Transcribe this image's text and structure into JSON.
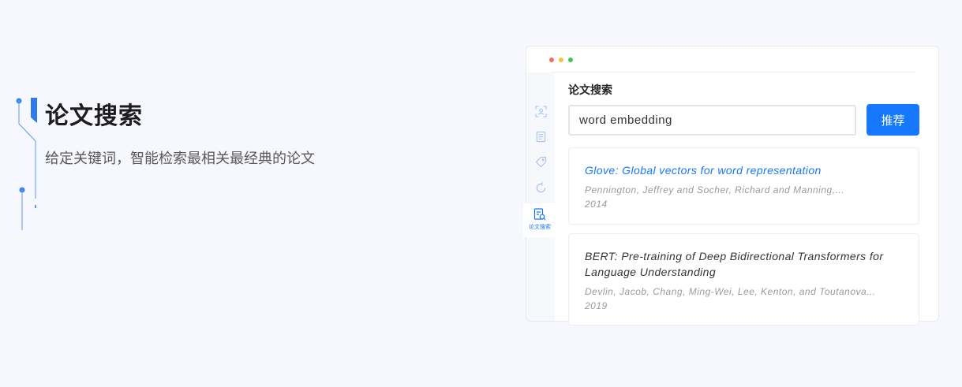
{
  "hero": {
    "title": "论文搜索",
    "subtitle": "给定关键词，智能检索最相关最经典的论文"
  },
  "window": {
    "sidebar": {
      "items": [
        {
          "icon": "scan-icon"
        },
        {
          "icon": "document-list-icon"
        },
        {
          "icon": "tag-icon"
        },
        {
          "icon": "refresh-icon"
        },
        {
          "icon": "paper-search-icon",
          "label": "论文搜索",
          "active": true
        }
      ]
    },
    "main": {
      "heading": "论文搜索",
      "search": {
        "value": "word embedding"
      },
      "recommend_button": "推荐",
      "results": [
        {
          "title": "Glove: Global vectors for word representation",
          "authors": "Pennington, Jeffrey and Socher, Richard and Manning,...",
          "year": "2014"
        },
        {
          "title": "BERT: Pre-training of Deep Bidirectional Transformers for Language Understanding",
          "authors": "Devlin, Jacob, Chang, Ming-Wei, Lee, Kenton, and Toutanova...",
          "year": "2019"
        }
      ]
    }
  },
  "colors": {
    "page_background": "#f7f8fd",
    "accent": "#1677ff",
    "sidebar_icon": "#a9c3ee",
    "window_controls": [
      "#f56c5c",
      "#f7c04a",
      "#3fc952"
    ]
  }
}
